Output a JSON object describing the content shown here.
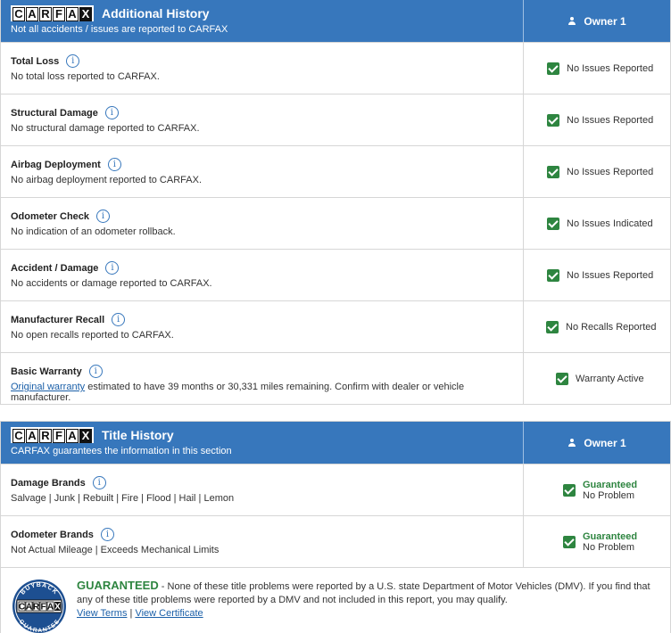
{
  "brand": {
    "logo_letters": [
      "C",
      "A",
      "R",
      "F",
      "A",
      "X"
    ],
    "accent": "#3777bc",
    "check": "#2e8540"
  },
  "additional": {
    "title": "Additional History",
    "subtitle": "Not all accidents / issues are reported to CARFAX",
    "owner": "Owner 1",
    "rows": [
      {
        "title": "Total Loss",
        "desc": "No total loss reported to CARFAX.",
        "status": "No Issues Reported"
      },
      {
        "title": "Structural Damage",
        "desc": "No structural damage reported to CARFAX.",
        "status": "No Issues Reported"
      },
      {
        "title": "Airbag Deployment",
        "desc": "No airbag deployment reported to CARFAX.",
        "status": "No Issues Reported"
      },
      {
        "title": "Odometer Check",
        "desc": "No indication of an odometer rollback.",
        "status": "No Issues Indicated"
      },
      {
        "title": "Accident / Damage",
        "desc": "No accidents or damage reported to CARFAX.",
        "status": "No Issues Reported"
      },
      {
        "title": "Manufacturer Recall",
        "desc": "No open recalls reported to CARFAX.",
        "status": "No Recalls Reported"
      }
    ],
    "warranty": {
      "title": "Basic Warranty",
      "link": "Original warranty",
      "desc_rest": " estimated to have 39 months or 30,331 miles remaining. Confirm with dealer or vehicle manufacturer.",
      "status": "Warranty Active"
    }
  },
  "title_history": {
    "title": "Title History",
    "subtitle": "CARFAX guarantees the information in this section",
    "owner": "Owner 1",
    "rows": [
      {
        "title": "Damage Brands",
        "desc": "Salvage | Junk | Rebuilt | Fire | Flood | Hail | Lemon",
        "status_top": "Guaranteed",
        "status_bottom": "No Problem"
      },
      {
        "title": "Odometer Brands",
        "desc": "Not Actual Mileage | Exceeds Mechanical Limits",
        "status_top": "Guaranteed",
        "status_bottom": "No Problem"
      }
    ]
  },
  "footer": {
    "heading": "GUARANTEED",
    "body": " - None of these title problems were reported by a U.S. state Department of Motor Vehicles (DMV). If you find that any of these title problems were reported by a DMV and not included in this report, you may qualify.",
    "link_terms": "View Terms",
    "separator": " | ",
    "link_cert": "View Certificate",
    "seal_top": "BUYBACK",
    "seal_bottom": "GUARANTEE"
  }
}
